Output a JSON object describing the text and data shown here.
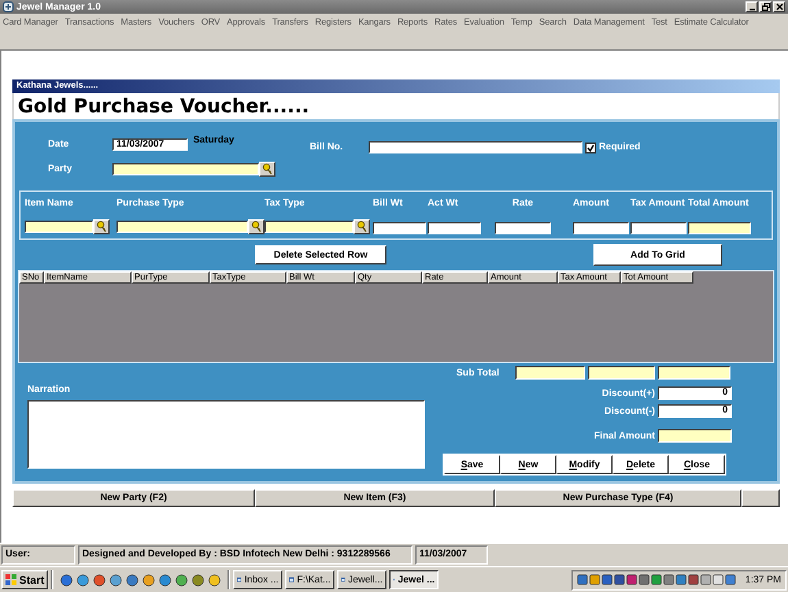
{
  "window": {
    "title": "Jewel Manager 1.0"
  },
  "menu": [
    "Card Manager",
    "Transactions",
    "Masters",
    "Vouchers",
    "ORV",
    "Approvals",
    "Transfers",
    "Registers",
    "Kangars",
    "Reports",
    "Rates",
    "Evaluation",
    "Temp",
    "Search",
    "Data Management",
    "Test",
    "Estimate Calculator"
  ],
  "form": {
    "company": "Kathana Jewels......",
    "title": "Gold Purchase Voucher......",
    "date": {
      "label": "Date",
      "value": "11/03/2007",
      "day": "Saturday"
    },
    "bill_no": {
      "label": "Bill No.",
      "required": {
        "label": "Required",
        "checked": true
      }
    },
    "party": {
      "label": "Party",
      "kind": "lookup"
    },
    "item_fields": [
      {
        "label": "Item Name",
        "kind": "lookup"
      },
      {
        "label": "Purchase Type",
        "kind": "lookup"
      },
      {
        "label": "Tax Type",
        "kind": "lookup"
      },
      {
        "label": "Bill Wt",
        "kind": "input"
      },
      {
        "label": "Act Wt",
        "kind": "input"
      },
      {
        "label": "Rate",
        "kind": "input"
      },
      {
        "label": "Amount",
        "kind": "input"
      },
      {
        "label": "Tax Amount",
        "kind": "input"
      },
      {
        "label": "Total Amount",
        "kind": "readonly"
      }
    ],
    "delete_row_button": "Delete Selected Row",
    "add_button": "Add To Grid",
    "grid": {
      "columns": [
        "SNo",
        "ItemName",
        "PurType",
        "TaxType",
        "Bill Wt",
        "Qty",
        "Rate",
        "Amount",
        "Tax Amount",
        "Tot Amount"
      ]
    },
    "narration": {
      "label": "Narration"
    },
    "sub_total": {
      "label": "Sub Total"
    },
    "discount_plus": {
      "label": "Discount(+)",
      "value": "0"
    },
    "discount_minus": {
      "label": "Discount(-)",
      "value": "0"
    },
    "final_amount": {
      "label": "Final Amount"
    },
    "actions": [
      "Save",
      "New",
      "Modify",
      "Delete",
      "Close"
    ],
    "shortcuts": [
      "New Party (F2)",
      "New Item (F3)",
      "New Purchase Type (F4)"
    ]
  },
  "status_bar": {
    "user": "User:",
    "credit": "Designed and Developed By : BSD Infotech New Delhi : 9312289566",
    "date": "11/03/2007"
  },
  "taskbar": {
    "start": "Start",
    "tasks": [
      {
        "label": "Inbox ...",
        "selected": false
      },
      {
        "label": "F:\\Kat...",
        "selected": false
      },
      {
        "label": "Jewell...",
        "selected": false
      },
      {
        "label": "Jewel ...",
        "selected": true
      }
    ],
    "clock": "1:37 PM"
  }
}
